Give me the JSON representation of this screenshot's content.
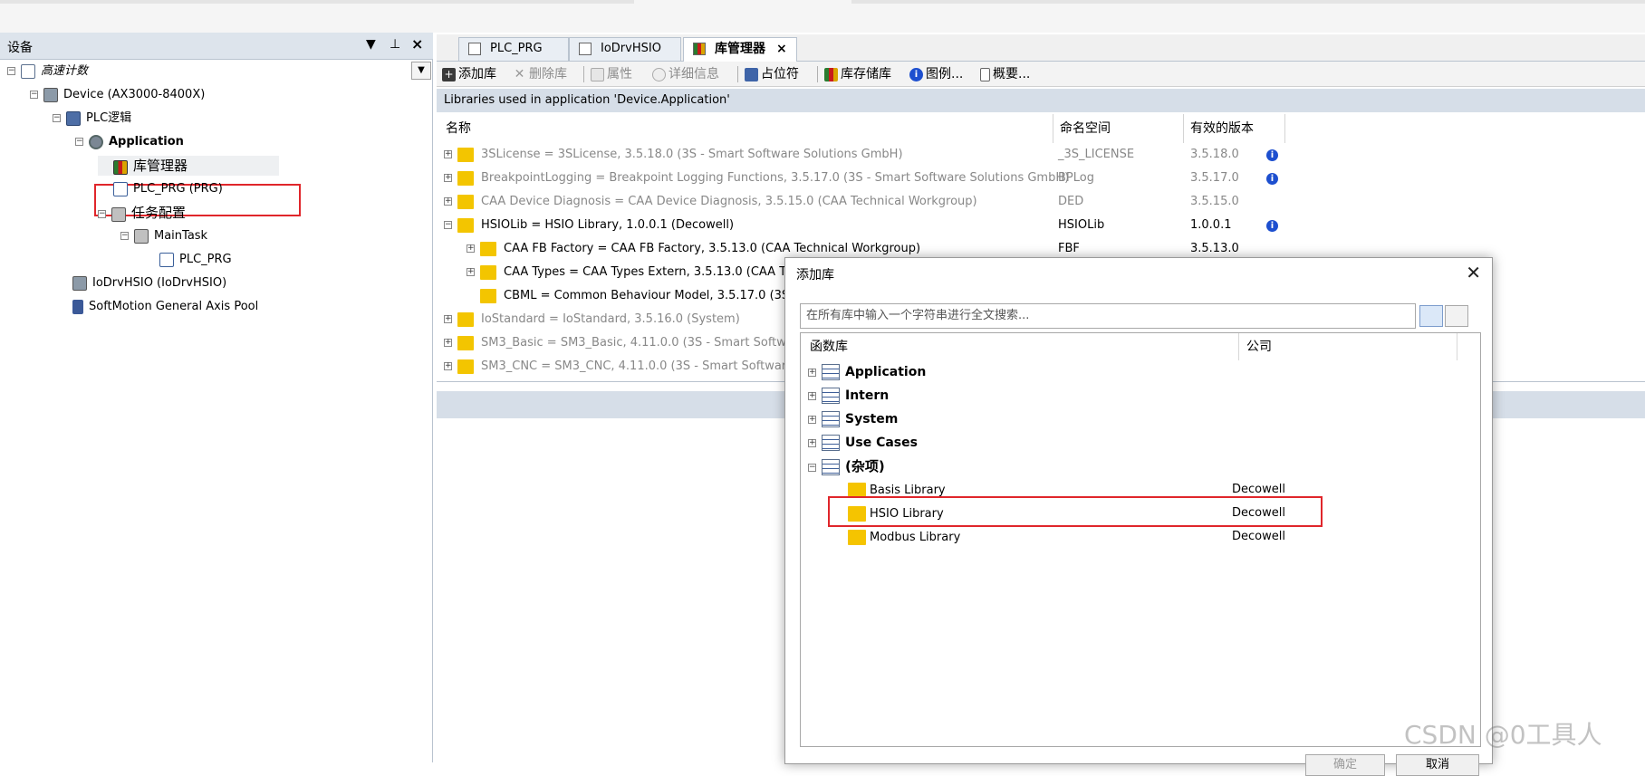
{
  "devices_panel": {
    "title": "设备",
    "controls": [
      "▼",
      "⊥",
      "×"
    ],
    "tree": [
      {
        "label": "高速计数",
        "style": "italic",
        "icon": "project-icon"
      },
      {
        "label": "Device (AX3000-8400X)",
        "icon": "device-icon"
      },
      {
        "label": "PLC逻辑",
        "icon": "plc-logic-icon"
      },
      {
        "label": "Application",
        "style": "bold",
        "icon": "application-gear-icon"
      },
      {
        "label": "库管理器",
        "icon": "library-manager-icon"
      },
      {
        "label": "PLC_PRG (PRG)",
        "icon": "program-icon"
      },
      {
        "label": "任务配置",
        "icon": "task-config-icon"
      },
      {
        "label": "MainTask",
        "icon": "task-icon"
      },
      {
        "label": "PLC_PRG",
        "icon": "program-call-icon"
      },
      {
        "label": "IoDrvHSIO (IoDrvHSIO)",
        "icon": "io-driver-icon"
      },
      {
        "label": "SoftMotion General Axis Pool",
        "icon": "axis-pool-icon"
      }
    ]
  },
  "tabs": [
    {
      "label": "PLC_PRG"
    },
    {
      "label": "IoDrvHSIO"
    },
    {
      "label": "库管理器",
      "active": true,
      "close": "×"
    }
  ],
  "toolbar": {
    "add_lib": "添加库",
    "del_lib": "删除库",
    "properties": "属性",
    "details": "详细信息",
    "placeholder": "占位符",
    "lib_repo": "库存储库",
    "legend": "图例...",
    "summary": "概要..."
  },
  "info_text": "Libraries used in application 'Device.Application'",
  "library_table": {
    "headers": {
      "name": "名称",
      "namespace": "命名空间",
      "version": "有效的版本"
    },
    "rows": [
      {
        "name": "3SLicense = 3SLicense, 3.5.18.0 (3S - Smart Software Solutions GmbH)",
        "namespace": "_3S_LICENSE",
        "version": "3.5.18.0",
        "info": "i",
        "grey": true
      },
      {
        "name": "BreakpointLogging = Breakpoint Logging Functions, 3.5.17.0 (3S - Smart Software Solutions GmbH)",
        "namespace": "BPLog",
        "version": "3.5.17.0",
        "info": "i",
        "grey": true
      },
      {
        "name": "CAA Device Diagnosis = CAA Device Diagnosis, 3.5.15.0 (CAA Technical Workgroup)",
        "namespace": "DED",
        "version": "3.5.15.0",
        "info": "",
        "grey": true
      },
      {
        "name": "HSIOLib = HSIO Library, 1.0.0.1 (Decowell)",
        "namespace": "HSIOLib",
        "version": "1.0.0.1",
        "info": "i",
        "grey": false
      },
      {
        "name": "CAA FB Factory = CAA FB Factory, 3.5.13.0 (CAA Technical Workgroup)",
        "namespace": "FBF",
        "version": "3.5.13.0",
        "info": "",
        "grey": false,
        "child": true
      },
      {
        "name": "CAA Types = CAA Types Extern, 3.5.13.0 (CAA T",
        "namespace": "",
        "version": "",
        "info": "",
        "grey": false,
        "child": true
      },
      {
        "name": "CBML = Common Behaviour Model, 3.5.17.0 (3S -",
        "namespace": "",
        "version": "",
        "info": "",
        "grey": false,
        "child": true,
        "leaf": true
      },
      {
        "name": "IoStandard = IoStandard, 3.5.16.0 (System)",
        "namespace": "",
        "version": "",
        "info": "",
        "grey": true
      },
      {
        "name": "SM3_Basic = SM3_Basic, 4.11.0.0 (3S - Smart Softwar",
        "namespace": "",
        "version": "",
        "info": "",
        "grey": true
      },
      {
        "name": "SM3_CNC = SM3_CNC, 4.11.0.0 (3S - Smart Software",
        "namespace": "",
        "version": "",
        "info": "",
        "grey": true
      }
    ]
  },
  "dialog": {
    "title": "添加库",
    "close": "✕",
    "search_placeholder": "在所有库中输入一个字符串进行全文搜索...",
    "headers": {
      "library": "函数库",
      "company": "公司"
    },
    "categories": [
      {
        "label": "Application",
        "pm": "+"
      },
      {
        "label": "Intern",
        "pm": "+"
      },
      {
        "label": "System",
        "pm": "+"
      },
      {
        "label": "Use Cases",
        "pm": "+"
      },
      {
        "label": "(杂项)",
        "pm": "−"
      }
    ],
    "items": [
      {
        "label": "Basis Library",
        "company": "Decowell"
      },
      {
        "label": "HSIO Library",
        "company": "Decowell"
      },
      {
        "label": "Modbus Library",
        "company": "Decowell"
      }
    ],
    "ok": "确定",
    "cancel": "取消"
  },
  "watermark": "CSDN @0工具人"
}
